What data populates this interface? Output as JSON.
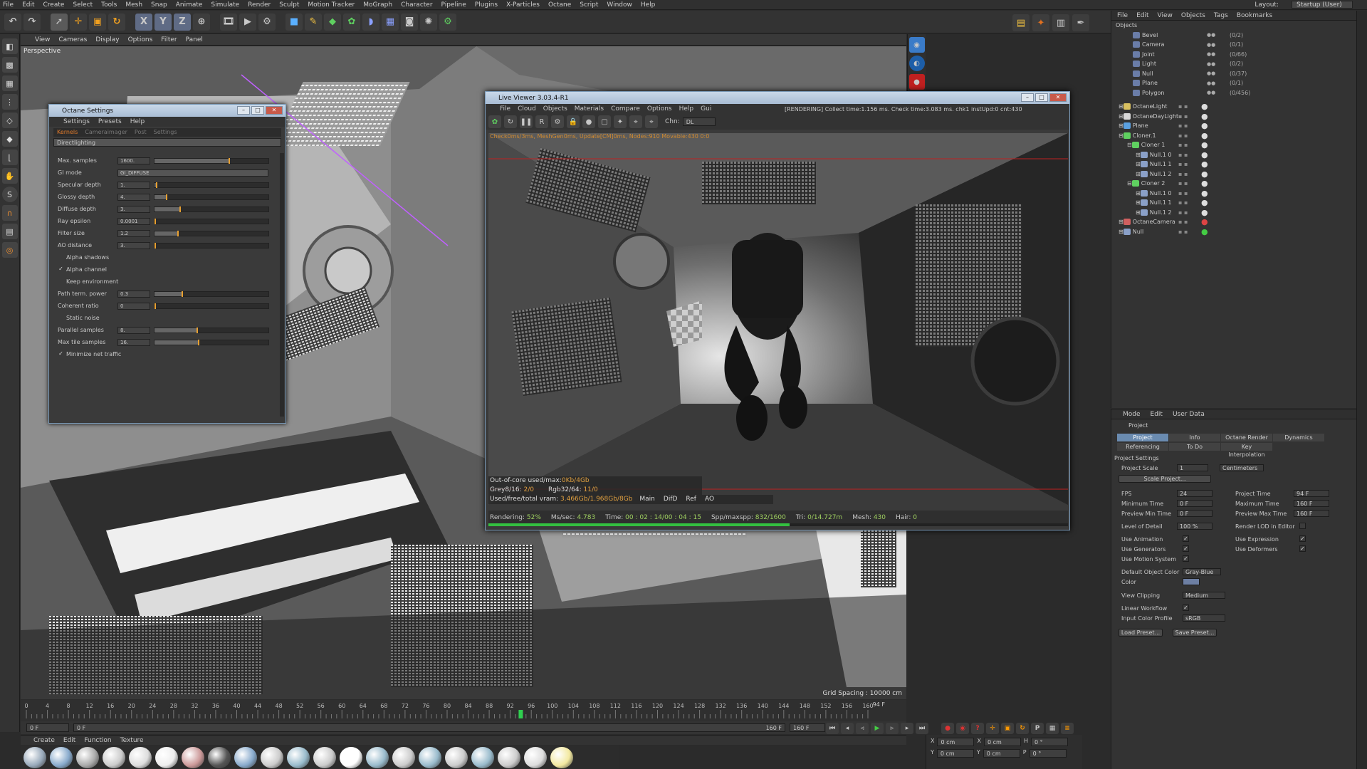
{
  "menubar": {
    "items": [
      "File",
      "Edit",
      "Create",
      "Select",
      "Tools",
      "Mesh",
      "Snap",
      "Animate",
      "Simulate",
      "Render",
      "Sculpt",
      "Motion Tracker",
      "MoGraph",
      "Character",
      "Pipeline",
      "Plugins",
      "X-Particles",
      "Octane",
      "Script",
      "Window",
      "Help"
    ],
    "layout_label": "Layout:",
    "layout_value": "Startup (User)"
  },
  "viewport": {
    "menu": [
      "View",
      "Cameras",
      "Display",
      "Options",
      "Filter",
      "Panel"
    ],
    "label": "Perspective",
    "grid_spacing": "Grid Spacing : 10000 cm"
  },
  "timeline": {
    "ticks": [
      "0",
      "4",
      "8",
      "12",
      "16",
      "20",
      "24",
      "28",
      "32",
      "36",
      "40",
      "44",
      "48",
      "52",
      "56",
      "60",
      "64",
      "68",
      "72",
      "76",
      "80",
      "84",
      "88",
      "92",
      "96",
      "100",
      "104",
      "108",
      "112",
      "116",
      "120",
      "124",
      "128",
      "132",
      "136",
      "140",
      "144",
      "148",
      "152",
      "156",
      "160"
    ],
    "current": "94 F",
    "start": "0 F",
    "start2": "0 F",
    "end": "160 F",
    "end2": "160 F",
    "current_marker": "0 F"
  },
  "materials": {
    "menu": [
      "Create",
      "Edit",
      "Function",
      "Texture"
    ]
  },
  "coords": {
    "rows": [
      [
        "X",
        "0 cm",
        "X",
        "0 cm",
        "H",
        "0 °"
      ],
      [
        "Y",
        "0 cm",
        "Y",
        "0 cm",
        "P",
        "0 °"
      ]
    ]
  },
  "octane_settings": {
    "title": "Octane Settings",
    "menu": [
      "Settings",
      "Presets",
      "Help"
    ],
    "tabs": [
      "Kernels",
      "Cameraimager",
      "Post",
      "Settings"
    ],
    "active_tab": "Kernels",
    "kernel": "Directlighting",
    "params": [
      {
        "label": "Max. samples",
        "value": "1600.",
        "fill": 0.65
      },
      {
        "label": "GI mode",
        "value": "GI_DIFFUSE",
        "fill": null
      },
      {
        "label": "Specular depth",
        "value": "1.",
        "fill": 0.01
      },
      {
        "label": "Glossy depth",
        "value": "4.",
        "fill": 0.1
      },
      {
        "label": "Diffuse depth",
        "value": "3.",
        "fill": 0.22
      },
      {
        "label": "Ray epsilon",
        "value": "0.0001",
        "fill": 0.0
      },
      {
        "label": "Filter size",
        "value": "1.2",
        "fill": 0.2
      },
      {
        "label": "AO distance",
        "value": "3.",
        "fill": 0.0
      }
    ],
    "checks": [
      {
        "label": "Alpha shadows",
        "checked": false
      },
      {
        "label": "Alpha channel",
        "checked": true
      },
      {
        "label": "Keep environment",
        "checked": false
      }
    ],
    "params2": [
      {
        "label": "Path term. power",
        "value": "0.3",
        "fill": 0.24
      },
      {
        "label": "Coherent ratio",
        "value": "0",
        "fill": 0.0
      }
    ],
    "checks2": [
      {
        "label": "Static noise",
        "checked": false
      }
    ],
    "params3": [
      {
        "label": "Parallel samples",
        "value": "8.",
        "fill": 0.37
      },
      {
        "label": "Max tile samples",
        "value": "16.",
        "fill": 0.38
      }
    ],
    "checks3": [
      {
        "label": "Minimize net traffic",
        "checked": true
      }
    ]
  },
  "live_viewer": {
    "title": "Live Viewer 3.03.4-R1",
    "menu": [
      "File",
      "Cloud",
      "Objects",
      "Materials",
      "Compare",
      "Options",
      "Help",
      "Gui"
    ],
    "status": "[RENDERING] Collect time:1.156 ms. Check time:3.083 ms. chk1 instUpd:0 cnt:430",
    "chn_label": "Chn:",
    "chn_value": "DL",
    "check_line": "Check0ms/3ms, MeshGen0ms, Update[CM]0ms, Nodes:910 Movable:430 0:0",
    "stats": [
      "Out-of-core used/max:",
      "0Kb/4Gb",
      "Grey8/16:",
      "2/0",
      "Rgb32/64:",
      "11/0",
      "Used/free/total vram:",
      "3.466Gb/1.968Gb/8Gb"
    ],
    "passes": [
      "Main",
      "DifD",
      "Ref",
      "AO"
    ],
    "rendering_label": "Rendering:",
    "rendering": "52%",
    "ms_label": "Ms/sec:",
    "ms": "4.783",
    "time_label": "Time:",
    "time": "00 : 02 : 14/00 : 04 : 15",
    "spp_label": "Spp/maxspp:",
    "spp": "832/1600",
    "tri_label": "Tri:",
    "tri": "0/14.727m",
    "mesh_label": "Mesh:",
    "mesh": "430",
    "hair_label": "Hair:",
    "hair": "0",
    "progress": 0.52
  },
  "objects": {
    "menu": [
      "File",
      "Edit",
      "View",
      "Objects",
      "Tags",
      "Bookmarks"
    ],
    "header": "Objects",
    "inner": [
      {
        "name": "Bevel",
        "count": "(0/2)"
      },
      {
        "name": "Camera",
        "count": "(0/1)"
      },
      {
        "name": "Joint",
        "count": "(0/66)"
      },
      {
        "name": "Light",
        "count": "(0/2)"
      },
      {
        "name": "Null",
        "count": "(0/37)"
      },
      {
        "name": "Plane",
        "count": "(0/1)"
      },
      {
        "name": "Polygon",
        "count": "(0/456)"
      }
    ],
    "tree": [
      {
        "name": "OctaneLight",
        "indent": 0
      },
      {
        "name": "OctaneDayLight",
        "indent": 0
      },
      {
        "name": "Plane",
        "indent": 0
      },
      {
        "name": "Cloner.1",
        "indent": 0
      },
      {
        "name": "Cloner 1",
        "indent": 1
      },
      {
        "name": "Null.1 0",
        "indent": 2
      },
      {
        "name": "Null.1 1",
        "indent": 2
      },
      {
        "name": "Null.1 2",
        "indent": 2
      },
      {
        "name": "Cloner 2",
        "indent": 1
      },
      {
        "name": "Null.1 0",
        "indent": 2
      },
      {
        "name": "Null.1 1",
        "indent": 2
      },
      {
        "name": "Null.1 2",
        "indent": 2
      },
      {
        "name": "OctaneCamera",
        "indent": 0
      },
      {
        "name": "Null",
        "indent": 0
      }
    ]
  },
  "attributes": {
    "menu": [
      "Mode",
      "Edit",
      "User Data"
    ],
    "object": "Project",
    "tabs": [
      "Project Settings",
      "Info",
      "Octane Render",
      "Dynamics",
      "Referencing",
      "To Do",
      "Key Interpolation"
    ],
    "section": "Project Settings",
    "project_scale_label": "Project Scale",
    "project_scale": "1",
    "project_scale_unit": "Centimeters",
    "scale_button": "Scale Project...",
    "fps_label": "FPS",
    "fps": "24",
    "project_time_label": "Project Time",
    "project_time": "94 F",
    "min_time_label": "Minimum Time",
    "min_time": "0 F",
    "max_time_label": "Maximum Time",
    "max_time": "160 F",
    "prev_min_label": "Preview Min Time",
    "prev_min": "0 F",
    "prev_max_label": "Preview Max Time",
    "prev_max": "160 F",
    "lod_label": "Level of Detail",
    "lod": "100 %",
    "render_lod_label": "Render LOD in Editor",
    "use_anim": "Use Animation",
    "use_expr": "Use Expression",
    "use_gen": "Use Generators",
    "use_def": "Use Deformers",
    "use_motion": "Use Motion System",
    "doc_label": "Default Object Color",
    "doc": "Gray-Blue",
    "color_label": "Color",
    "clip_label": "View Clipping",
    "clip": "Medium",
    "linear_label": "Linear Workflow",
    "icp_label": "Input Color Profile",
    "icp": "sRGB",
    "load_preset": "Load Preset...",
    "save_preset": "Save Preset..."
  }
}
